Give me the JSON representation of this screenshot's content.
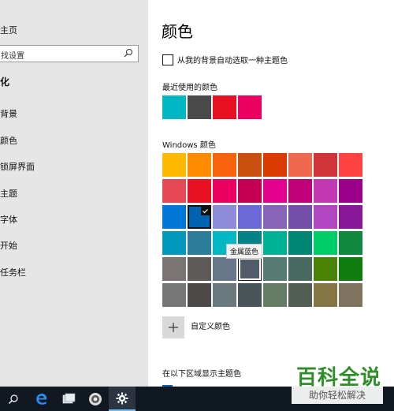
{
  "sidebar": {
    "home": "主页",
    "search_text": "找设置",
    "section_title": "化",
    "items": [
      "背景",
      "颜色",
      "锁屏界面",
      "主题",
      "字体",
      "开始",
      "任务栏"
    ]
  },
  "main": {
    "title": "颜色",
    "auto_pick_label": "从我的背景自动选取一种主题色",
    "recent_label": "最近使用的颜色",
    "recent_colors": [
      "#00b7c3",
      "#4a4a4a",
      "#e81123",
      "#ea005e"
    ],
    "windows_label": "Windows 颜色",
    "windows_colors": [
      [
        "#ffb900",
        "#ff8c00",
        "#f7630c",
        "#ca5010",
        "#da3b01",
        "#ef6950",
        "#d13438",
        "#ff4343"
      ],
      [
        "#e74856",
        "#e81123",
        "#ea005e",
        "#c30052",
        "#e3008c",
        "#bf0077",
        "#c239b3",
        "#9a0089"
      ],
      [
        "#0078d7",
        "#0063b1",
        "#8e8cd8",
        "#6b69d6",
        "#8764b8",
        "#744da9",
        "#b146c2",
        "#881798"
      ],
      [
        "#0099bc",
        "#2d7d9a",
        "#00b7c3",
        "#038387",
        "#00b294",
        "#018574",
        "#00cc6a",
        "#10893e"
      ],
      [
        "#7a7574",
        "#5d5a58",
        "#68768a",
        "#515c6b",
        "#567c73",
        "#486860",
        "#498205",
        "#107c10"
      ],
      [
        "#767676",
        "#4c4a48",
        "#69797e",
        "#4a5459",
        "#647c64",
        "#525e54",
        "#847545",
        "#7e735f"
      ]
    ],
    "selected_color": "#0063b1",
    "tooltip": "金属蓝色",
    "custom_label": "自定义颜色",
    "bottom_label": "在以下区域显示主题色"
  },
  "watermark": {
    "main": "百科全说",
    "sub": "助你轻松解决"
  },
  "taskbar": {
    "icons": [
      "search-icon",
      "edge-icon",
      "app-icon",
      "app-icon-2",
      "settings-icon"
    ]
  }
}
